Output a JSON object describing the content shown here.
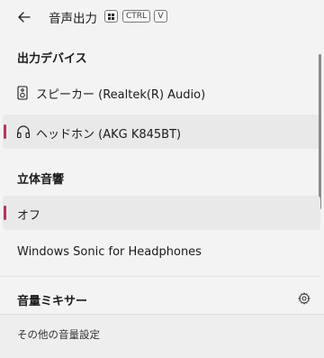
{
  "header": {
    "title": "音声出力",
    "shortcut": {
      "key_ctrl": "CTRL",
      "key_v": "V"
    }
  },
  "output_devices": {
    "label": "出力デバイス",
    "items": [
      {
        "label": "スピーカー (Realtek(R) Audio)",
        "icon": "speaker-icon",
        "selected": false
      },
      {
        "label": "ヘッドホン (AKG K845BT)",
        "icon": "headphones-icon",
        "selected": true
      }
    ]
  },
  "spatial_sound": {
    "label": "立体音響",
    "items": [
      {
        "label": "オフ",
        "selected": true
      },
      {
        "label": "Windows Sonic for Headphones",
        "selected": false
      }
    ]
  },
  "mixer": {
    "label": "音量ミキサー",
    "icon": "gear-icon"
  },
  "footer": {
    "link": "その他の音量設定"
  },
  "colors": {
    "accent": "#b3345d",
    "background": "#f3f3f3",
    "selected_bg": "#e9e9e9"
  }
}
